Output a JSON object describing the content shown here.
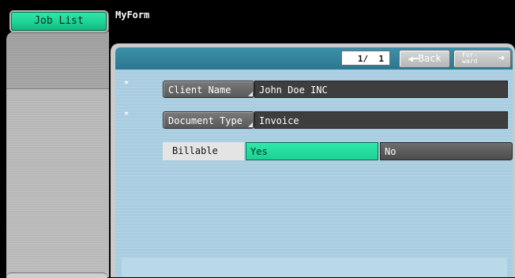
{
  "sidebar": {
    "job_list_label": "Job List"
  },
  "form": {
    "title": "MyForm",
    "page": {
      "current": "1/",
      "total": "1"
    },
    "back_label": "Back",
    "back_icon": "left-arrow-icon",
    "forward_label": "For- ward",
    "forward_icon": "right-arrow-icon",
    "required_marker": "*",
    "fields": [
      {
        "label": "Client Name",
        "value": "John Doe INC",
        "required": true
      },
      {
        "label": "Document Type",
        "value": "Invoice",
        "required": true
      }
    ],
    "billable": {
      "label": "Billable",
      "options": [
        "Yes",
        "No"
      ],
      "selected": "Yes"
    }
  },
  "colors": {
    "accent_green": "#1ed495",
    "toolbar_teal": "#2b7690",
    "content_blue": "#a9cde0"
  }
}
